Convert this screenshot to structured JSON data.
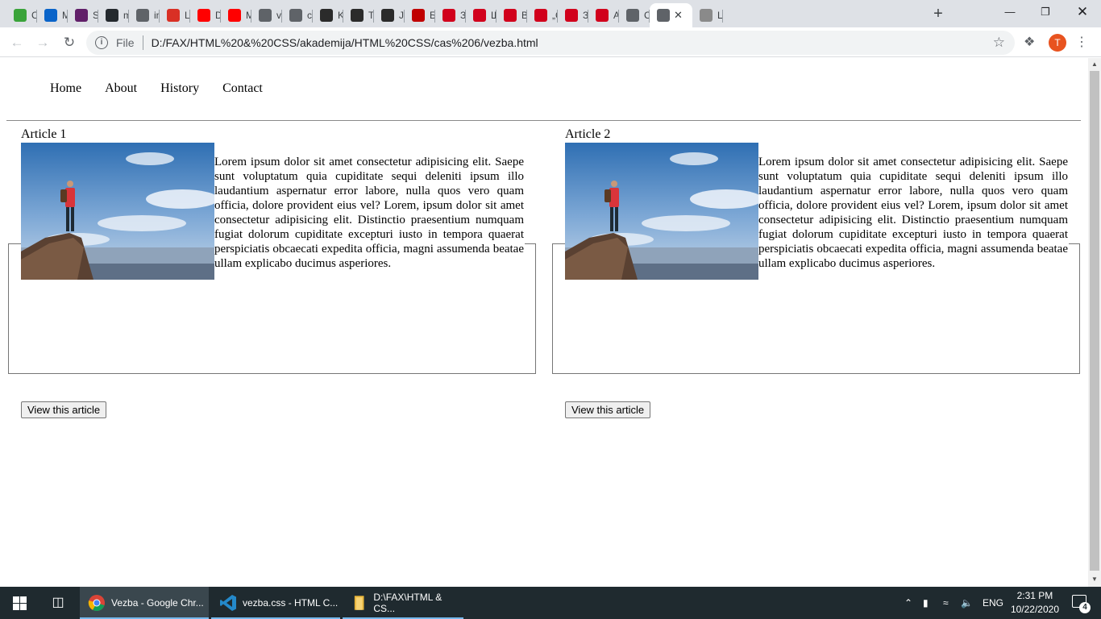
{
  "browser": {
    "tabs": [
      {
        "title": "CS",
        "favicon": "edu-icon",
        "color": "#3aa33a"
      },
      {
        "title": "M",
        "favicon": "outlook-icon",
        "color": "#0a64c9"
      },
      {
        "title": "Sl",
        "favicon": "slack-icon",
        "color": "#611f69"
      },
      {
        "title": "m",
        "favicon": "github-icon",
        "color": "#24292e"
      },
      {
        "title": "in",
        "favicon": "globe-icon",
        "color": "#5f6368"
      },
      {
        "title": "Le",
        "favicon": "leetcode-icon",
        "color": "#d93025"
      },
      {
        "title": "D.",
        "favicon": "youtube-icon",
        "color": "#ff0000"
      },
      {
        "title": "M",
        "favicon": "youtube-icon",
        "color": "#ff0000"
      },
      {
        "title": "ve",
        "favicon": "globe-icon",
        "color": "#5f6368"
      },
      {
        "title": "ca",
        "favicon": "globe-icon",
        "color": "#5f6368"
      },
      {
        "title": "K:",
        "favicon": "infinity-icon",
        "color": "#2b2b2b"
      },
      {
        "title": "Tr",
        "favicon": "infinity-icon",
        "color": "#2b2b2b"
      },
      {
        "title": "Ja",
        "favicon": "infinity-icon",
        "color": "#2b2b2b"
      },
      {
        "title": "Бі",
        "favicon": "mko-icon",
        "color": "#c00000"
      },
      {
        "title": "За",
        "favicon": "n-icon",
        "color": "#d1001c"
      },
      {
        "title": "Ш",
        "favicon": "n-icon",
        "color": "#d1001c"
      },
      {
        "title": "Ве",
        "favicon": "n-icon",
        "color": "#d1001c"
      },
      {
        "title": "„С",
        "favicon": "phi-icon",
        "color": "#d1001c"
      },
      {
        "title": "За",
        "favicon": "phi-icon",
        "color": "#d1001c"
      },
      {
        "title": "А",
        "favicon": "phi-icon",
        "color": "#d1001c"
      },
      {
        "title": "С",
        "favicon": "globe-icon",
        "color": "#5f6368"
      },
      {
        "title": "",
        "favicon": "globe-icon",
        "color": "#5f6368",
        "active": true
      },
      {
        "title": "Ц",
        "favicon": "crest-icon",
        "color": "#8a8a8a"
      }
    ],
    "omnibox": {
      "scheme": "File",
      "url": "D:/FAX/HTML%20&%20CSS/akademija/HTML%20CSS/cas%206/vezba.html"
    },
    "profile_initial": "T"
  },
  "page": {
    "nav": [
      "Home",
      "About",
      "History",
      "Contact"
    ],
    "articles": [
      {
        "legend": "Article 1",
        "text": "Lorem ipsum dolor sit amet consectetur adipisicing elit. Saepe sunt voluptatum quia cupiditate sequi deleniti ipsum illo laudantium aspernatur error labore, nulla quos vero quam officia, dolore provident eius vel? Lorem, ipsum dolor sit amet consectetur adipisicing elit. Distinctio praesentium numquam fugiat dolorum cupiditate excepturi iusto in tempora quaerat perspiciatis obcaecati expedita officia, magni assumenda beatae ullam explicabo ducimus asperiores.",
        "button": "View this article"
      },
      {
        "legend": "Article 2",
        "text": "Lorem ipsum dolor sit amet consectetur adipisicing elit. Saepe sunt voluptatum quia cupiditate sequi deleniti ipsum illo laudantium aspernatur error labore, nulla quos vero quam officia, dolore provident eius vel? Lorem, ipsum dolor sit amet consectetur adipisicing elit. Distinctio praesentium numquam fugiat dolorum cupiditate excepturi iusto in tempora quaerat perspiciatis obcaecati expedita officia, magni assumenda beatae ullam explicabo ducimus asperiores.",
        "button": "View this article"
      }
    ]
  },
  "taskbar": {
    "apps": [
      {
        "label": "Vezba - Google Chr...",
        "icon": "chrome-icon",
        "active": true
      },
      {
        "label": "vezba.css - HTML C...",
        "icon": "vscode-icon",
        "active": false
      },
      {
        "label": "D:\\FAX\\HTML & CS...",
        "icon": "folder-icon",
        "active": false
      }
    ],
    "language": "ENG",
    "time": "2:31 PM",
    "date": "10/22/2020",
    "notifications": "4"
  }
}
